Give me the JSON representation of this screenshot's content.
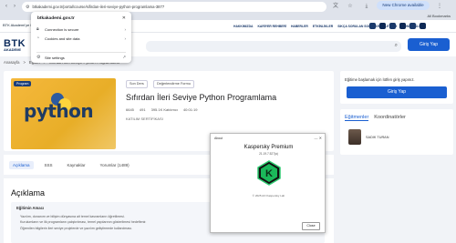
{
  "browser": {
    "url": "btkakademi.gov.tr/portal/course/sifirdan-ileri-seviye-python-programlama-3877",
    "new_chrome": "New Chrome available",
    "all_bookmarks": "All Bookmarks"
  },
  "site_info_popup": {
    "domain": "btkakademi.gov.tr",
    "rows": [
      {
        "label": "Connection is secure",
        "icon": "lock-icon"
      },
      {
        "label": "Cookies and site data",
        "icon": "cookie-icon"
      },
      {
        "label": "Site settings",
        "icon": "settings-icon"
      }
    ]
  },
  "site": {
    "brand_top": "BTK Akademi'ye Hoş Geldiniz",
    "logo": "BTK",
    "logo_sub": "AKADEMİ",
    "nav": [
      "HAKKIMIZDA",
      "KARİYER REHBERİ",
      "HABERLER",
      "ETKİNLİKLER",
      "SIKÇA SORULAN SORULAR",
      "İLETİŞİM",
      "GÖNÜLLÜLÜK"
    ],
    "login": "Giriş Yap",
    "breadcrumb": [
      "Anasayfa",
      ">",
      "Eğitim",
      ">",
      "Sıfırdan İleri Seviye Python Programlama"
    ]
  },
  "course": {
    "badge": "Program",
    "thumb_word": "python",
    "chip1": "Son Ders",
    "chip2": "Değerlendirme Formu",
    "title": "Sıfırdan İleri Seviye Python Programlama",
    "stats": [
      "6645",
      "491",
      "395.1K Katılımcı",
      "40:01:19"
    ],
    "certificate": "KATILIM SERTİFİKASI"
  },
  "tabs": [
    "Açıklama",
    "SSS",
    "Kaynaklar",
    "Yorumlar (1489)"
  ],
  "description": {
    "heading": "Açıklama",
    "box_title": "Eğitimin Amacı",
    "bullets": [
      "Yazılım, donanım ve bilişim dünyasına ait temel kavramların öğretilmesi.",
      "Kurulumların ve ilk programların çalıştırılması, temel yapılarının gösterilmesi hedeflenir.",
      "Öğrenilen bilgilerin ileri seviye projelerde ve yazılım geliştirmede kullanılması."
    ]
  },
  "side": {
    "prompt": "Eğitime başlamak için lütfen giriş yapınız.",
    "login": "Giriş Yap",
    "tab1": "Eğitmenler",
    "tab2": "Koordinatörler",
    "instructor": "SADIK TURAN"
  },
  "kaspersky": {
    "header": "About",
    "product": "Kaspersky Premium",
    "version": "21.19.7.527(a)",
    "copyright": "© 2025 AO Kaspersky Lab",
    "close": "Close",
    "accent": "#2ecc71"
  }
}
